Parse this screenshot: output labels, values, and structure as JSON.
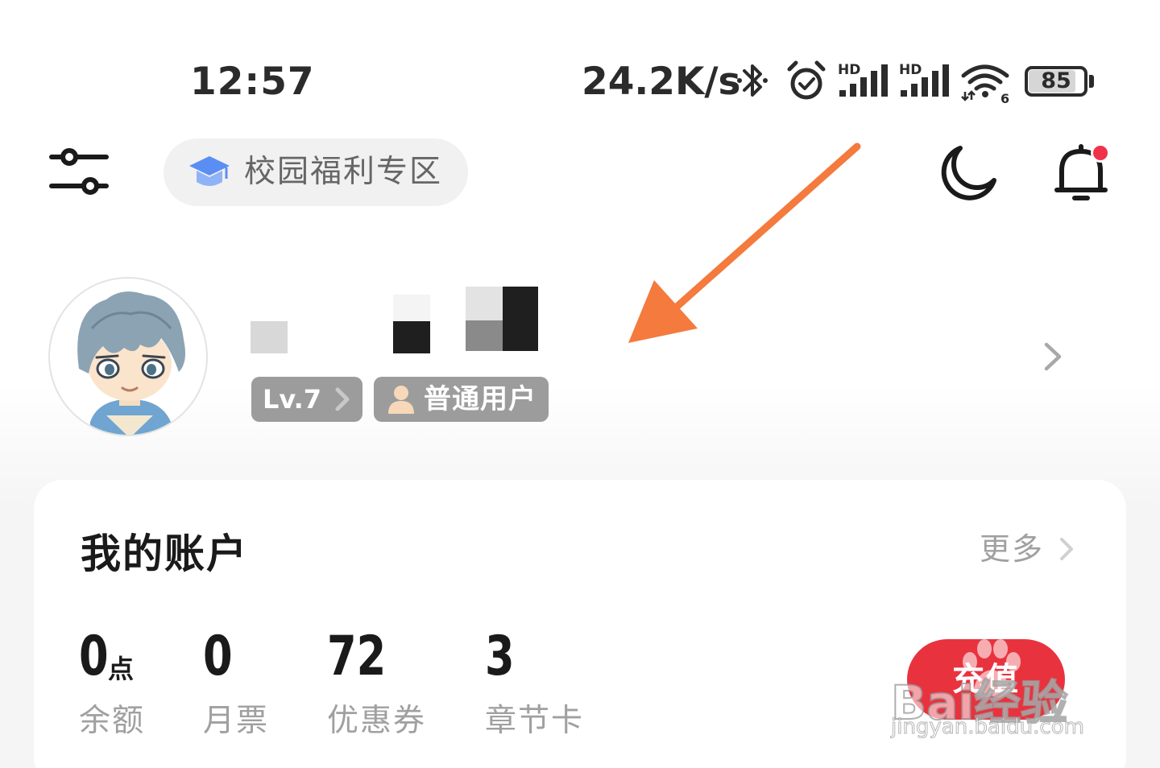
{
  "status_bar": {
    "time": "12:57",
    "net_speed": "24.2K/s",
    "icons": [
      "bluetooth-icon",
      "alarm-icon",
      "signal-hd-icon",
      "signal-hd-icon",
      "wifi-icon"
    ],
    "signal_hd_label": "HD",
    "wifi_sub_label": "6",
    "battery_level": "85",
    "battery_fraction": 0.85
  },
  "top_nav": {
    "settings_icon": "sliders-icon",
    "campus_icon": "graduation-cap-icon",
    "campus_label": "校园福利专区",
    "night_mode_icon": "moon-icon",
    "notification_icon": "bell-icon",
    "has_unread_notification": true
  },
  "profile": {
    "avatar_icon": "avatar-anime-boy",
    "username_obscured": true,
    "level_label": "Lv.7",
    "user_type_label": "普通用户",
    "user_type_icon": "person-icon"
  },
  "account": {
    "title": "我的账户",
    "more_label": "更多",
    "stats": [
      {
        "value": "0",
        "unit": "点",
        "label": "余额"
      },
      {
        "value": "0",
        "unit": "",
        "label": "月票"
      },
      {
        "value": "72",
        "unit": "",
        "label": "优惠券"
      },
      {
        "value": "3",
        "unit": "",
        "label": "章节卡"
      }
    ],
    "recharge_label": "充值"
  },
  "watermark": {
    "brand": "Bai经验",
    "url": "jingyan.baidu.com"
  },
  "colors": {
    "accent_red": "#e8333f",
    "badge_grey": "#9c9c9c",
    "annotation_orange": "#f47a3d",
    "notification_dot": "#f0334a"
  }
}
